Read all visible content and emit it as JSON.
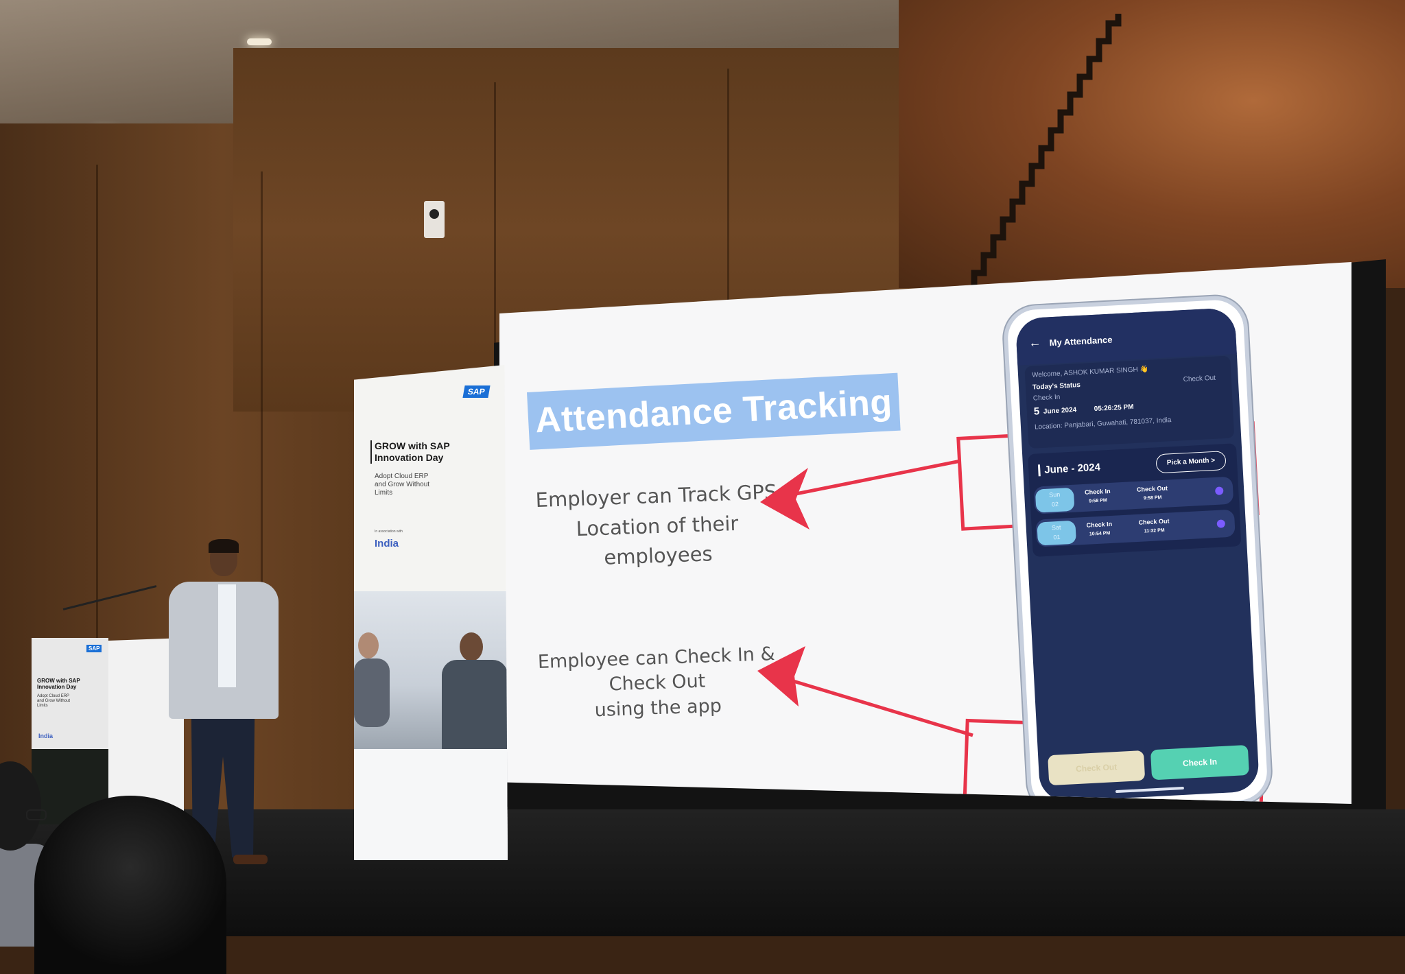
{
  "slide": {
    "title": "Attendance Tracking",
    "point_gps": "Employer can Track GPS\nLocation of their\nemployees",
    "point_check": "Employee can Check In &\nCheck Out\nusing the app",
    "accent_color": "#9cc2f0",
    "arrow_color": "#e8344a"
  },
  "phone": {
    "header_title": "My Attendance",
    "welcome": "Welcome, ASHOK KUMAR SINGH 👋",
    "todays_status": "Today's Status",
    "check_in_label": "Check In",
    "check_out_label": "Check Out",
    "date_day": "5",
    "date_rest": "June 2024",
    "time": "05:26:25 PM",
    "location": "Location: Panjabari, Guwahati, 781037, India",
    "month": "June - 2024",
    "pick_month": "Pick a Month >",
    "rows": [
      {
        "day": "Sun",
        "date": "02",
        "check_in_label": "Check In",
        "check_in": "9:58 PM",
        "check_out_label": "Check Out",
        "check_out": "9:58 PM"
      },
      {
        "day": "Sat",
        "date": "01",
        "check_in_label": "Check In",
        "check_in": "10:54 PM",
        "check_out_label": "Check Out",
        "check_out": "11:32 PM"
      }
    ],
    "check_out_button": "Check Out",
    "check_in_button": "Check In"
  },
  "banner": {
    "logo": "SAP",
    "heading": "GROW with SAP\nInnovation Day",
    "subheading": "Adopt Cloud ERP\nand Grow Without\nLimits",
    "association": "In association with",
    "partner": "India"
  },
  "podium": {
    "logo": "SAP",
    "heading": "GROW with SAP\nInnovation Day",
    "subheading": "Adopt Cloud ERP\nand Grow Without\nLimits",
    "partner": "India"
  }
}
